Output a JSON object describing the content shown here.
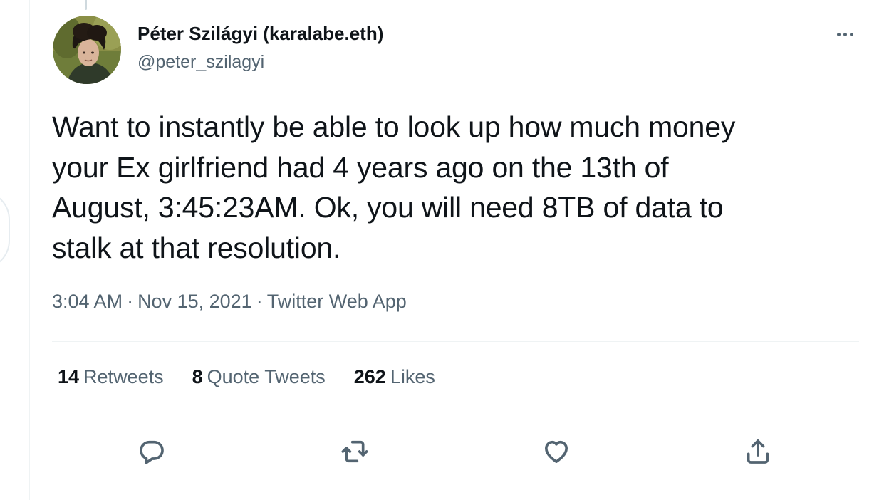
{
  "author": {
    "name": "Péter Szilágyi (karalabe.eth)",
    "handle": "@peter_szilagyi"
  },
  "tweet": {
    "lines": [
      "Want to instantly be able to look up how much money",
      "your Ex girlfriend had 4 years ago on the 13th of",
      "August, 3:45:23AM. Ok, you will need 8TB of data to",
      "stalk at that resolution."
    ],
    "time": "3:04 AM",
    "date": "Nov 15, 2021",
    "source": "Twitter Web App",
    "separator": "·"
  },
  "stats": {
    "retweets_count": "14",
    "retweets_label": "Retweets",
    "quotes_count": "8",
    "quotes_label": "Quote Tweets",
    "likes_count": "262",
    "likes_label": "Likes"
  },
  "icons": {
    "more": "more-horizontal-icon",
    "reply": "reply-icon",
    "retweet": "retweet-icon",
    "like": "heart-icon",
    "share": "share-icon"
  },
  "colors": {
    "text_primary": "#0f1419",
    "text_secondary": "#536471",
    "divider": "#eff3f4"
  }
}
